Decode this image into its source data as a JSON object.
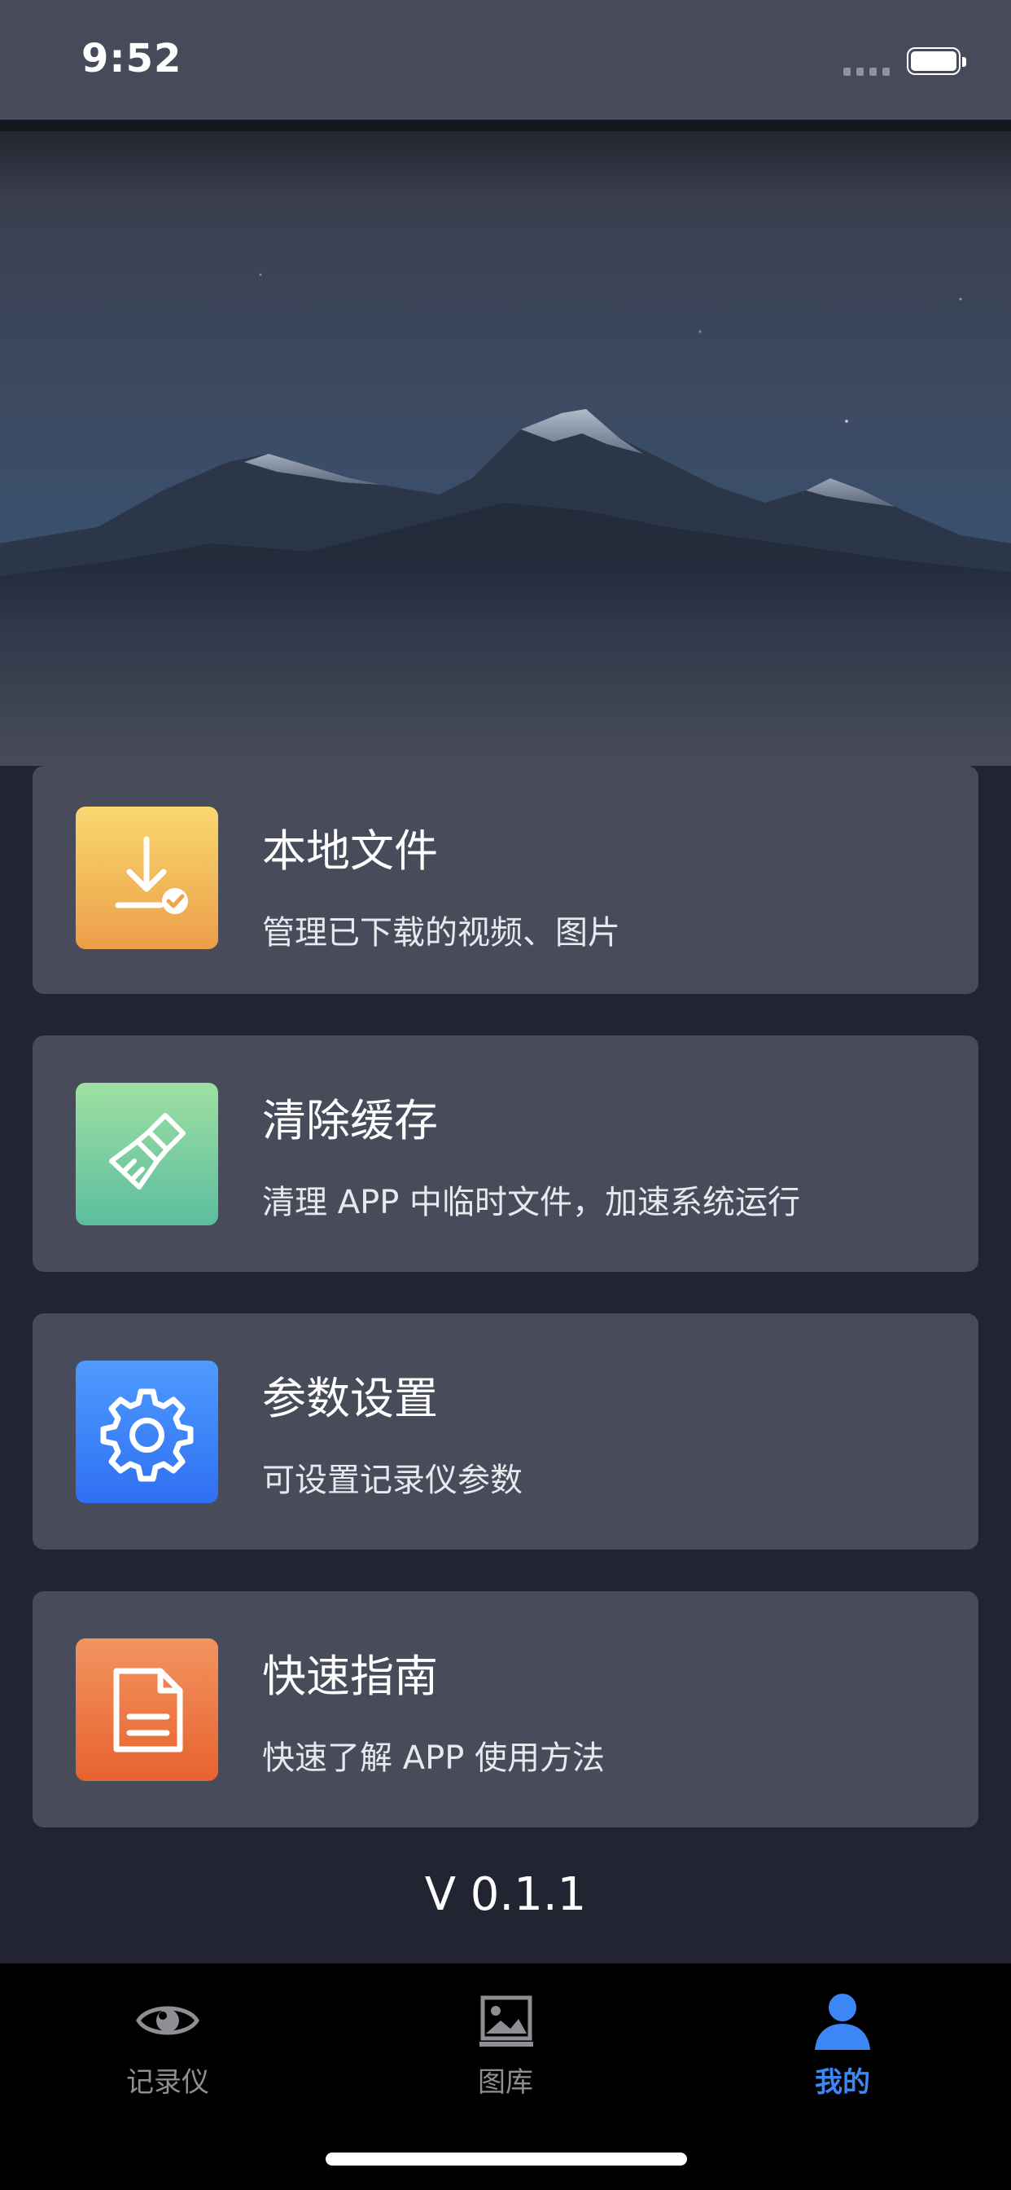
{
  "status_bar": {
    "time": "9:52"
  },
  "menu": {
    "items": [
      {
        "title": "本地文件",
        "subtitle": "管理已下载的视频、图片",
        "icon": "download-icon",
        "color": "#f0b556"
      },
      {
        "title": "清除缓存",
        "subtitle": "清理 APP 中临时文件，加速系统运行",
        "icon": "brush-icon",
        "color": "#7dcfa0"
      },
      {
        "title": "参数设置",
        "subtitle": "可设置记录仪参数",
        "icon": "gear-icon",
        "color": "#3f85f8"
      },
      {
        "title": "快速指南",
        "subtitle": "快速了解 APP 使用方法",
        "icon": "document-icon",
        "color": "#ec7a42"
      }
    ]
  },
  "version": "V 0.1.1",
  "tabbar": {
    "tabs": [
      {
        "label": "记录仪",
        "icon": "eye-icon",
        "active": false
      },
      {
        "label": "图库",
        "icon": "gallery-icon",
        "active": false
      },
      {
        "label": "我的",
        "icon": "person-icon",
        "active": true
      }
    ],
    "active_color": "#3d86f5",
    "inactive_color": "#8e8e93"
  }
}
